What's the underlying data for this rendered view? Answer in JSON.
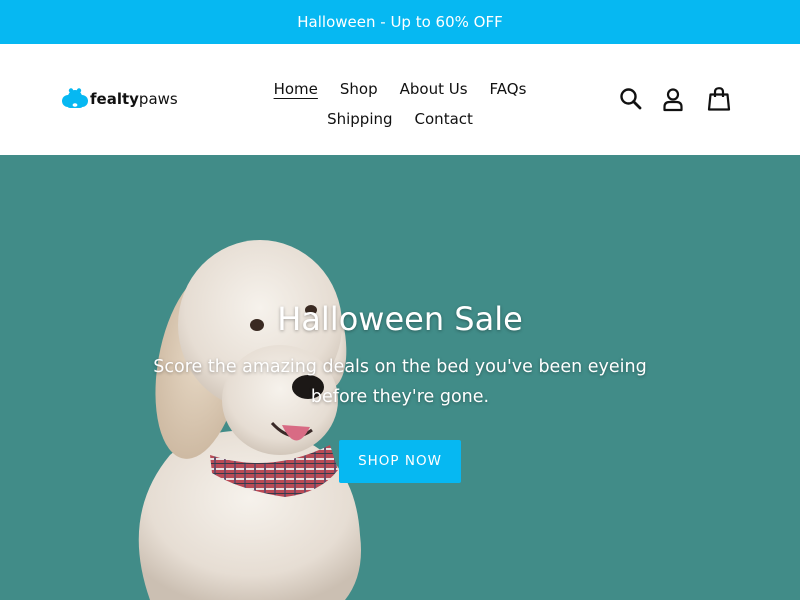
{
  "announcement": {
    "text": "Halloween - Up to 60% OFF"
  },
  "brand": {
    "name_bold": "fealty",
    "name_light": "paws",
    "logo_icon": "paw-cloud-icon",
    "accent": "#06b8f2"
  },
  "nav": {
    "items": [
      {
        "label": "Home",
        "active": true
      },
      {
        "label": "Shop"
      },
      {
        "label": "About Us"
      },
      {
        "label": "FAQs"
      },
      {
        "label": "Shipping"
      },
      {
        "label": "Contact"
      }
    ]
  },
  "header_icons": [
    "search-icon",
    "account-icon",
    "cart-icon"
  ],
  "hero": {
    "title": "Halloween Sale",
    "subtitle_line1": "Score the amazing deals on the bed you've been eyeing",
    "subtitle_line2": "before they're gone.",
    "button_label": "SHOP NOW",
    "background_color": "#418c88",
    "image": "dog-with-plaid-bandana"
  }
}
